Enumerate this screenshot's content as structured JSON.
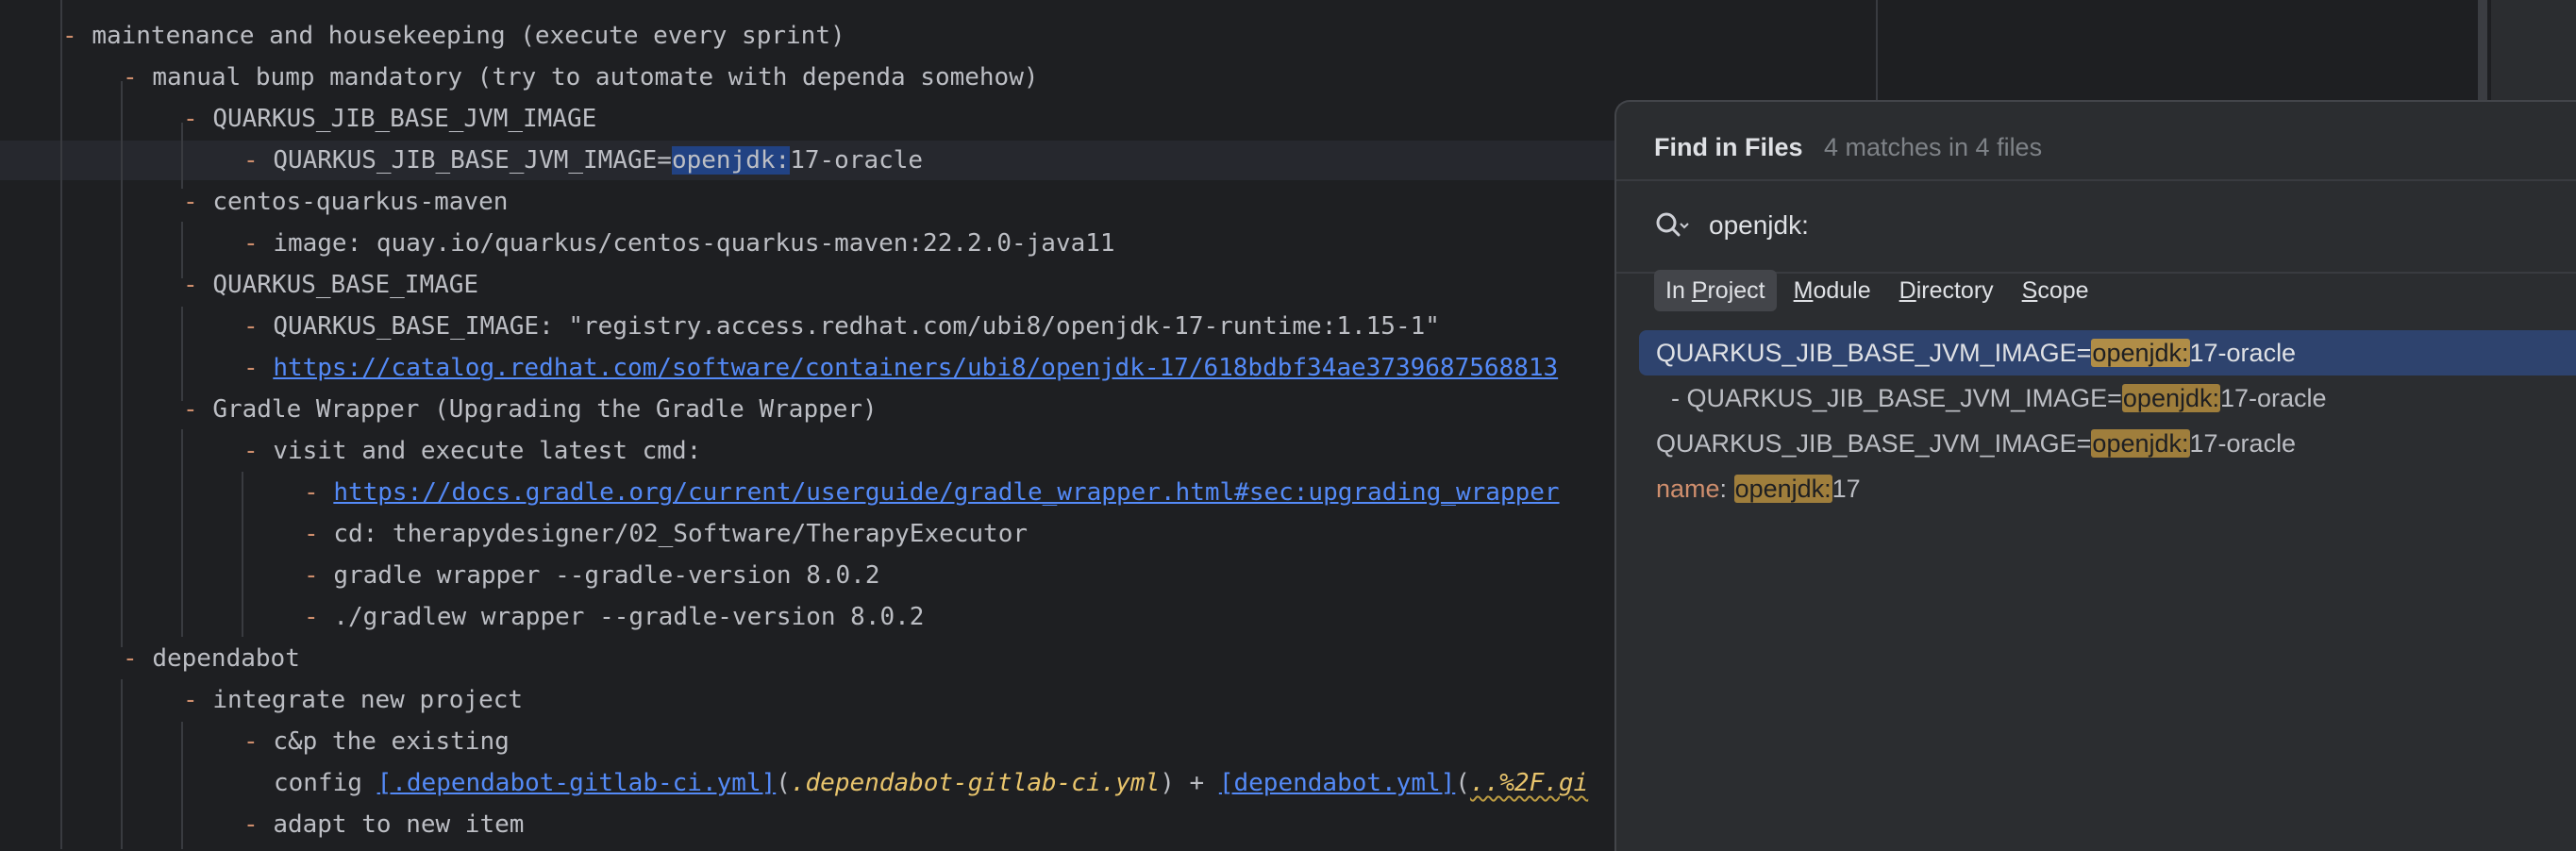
{
  "editor": {
    "lines": [
      {
        "text": "maintenance and housekeeping (execute every sprint)"
      },
      {
        "text": "manual bump mandatory (try to automate with dependa somehow)"
      },
      {
        "text": "QUARKUS_JIB_BASE_JVM_IMAGE"
      },
      {
        "prefix": "QUARKUS_JIB_BASE_JVM_IMAGE=",
        "selected": "openjdk:",
        "suffix": "17-oracle"
      },
      {
        "text": "centos-quarkus-maven"
      },
      {
        "text": "image: quay.io/quarkus/centos-quarkus-maven:22.2.0-java11"
      },
      {
        "text": "QUARKUS_BASE_IMAGE"
      },
      {
        "text": "QUARKUS_BASE_IMAGE: \"registry.access.redhat.com/ubi8/openjdk-17-runtime:1.15-1\""
      },
      {
        "link": "https://catalog.redhat.com/software/containers/ubi8/openjdk-17/618bdbf34ae3739687568813"
      },
      {
        "text": "Gradle Wrapper (Upgrading the Gradle Wrapper)"
      },
      {
        "text": "visit and execute latest cmd:"
      },
      {
        "link": "https://docs.gradle.org/current/userguide/gradle_wrapper.html#sec:upgrading_wrapper"
      },
      {
        "text": "cd: therapydesigner/02_Software/TherapyExecutor"
      },
      {
        "text": "gradle wrapper --gradle-version 8.0.2"
      },
      {
        "text": "./gradlew wrapper --gradle-version 8.0.2"
      },
      {
        "text": "dependabot"
      },
      {
        "text": "integrate new project"
      },
      {
        "text": "c&p the existing"
      },
      {
        "prefix": "config ",
        "link1": "[.dependabot-gitlab-ci.yml]",
        "paren1": "(",
        "ital1": ".dependabot-gitlab-ci.yml",
        "paren2": ") + ",
        "link2": "[dependabot.yml]",
        "paren3": "(",
        "squig": "..%2F.gi"
      },
      {
        "text": "adapt to new item"
      }
    ],
    "dash": "-"
  },
  "find": {
    "title": "Find in Files",
    "count": "4 matches in 4 files",
    "query": "openjdk:",
    "scopes": [
      {
        "pre": "In ",
        "mn": "P",
        "post": "roject"
      },
      {
        "pre": "",
        "mn": "M",
        "post": "odule"
      },
      {
        "pre": "",
        "mn": "D",
        "post": "irectory"
      },
      {
        "pre": "",
        "mn": "S",
        "post": "cope"
      }
    ],
    "results": [
      {
        "before": "QUARKUS_JIB_BASE_JVM_IMAGE=",
        "match": "openjdk:",
        "after": "17-oracle"
      },
      {
        "before": "- QUARKUS_JIB_BASE_JVM_IMAGE=",
        "match": "openjdk:",
        "after": "17-oracle"
      },
      {
        "before": "QUARKUS_JIB_BASE_JVM_IMAGE=",
        "match": "openjdk:",
        "after": "17-oracle"
      },
      {
        "key": "name",
        "before": ": ",
        "match": "openjdk:",
        "after": "17"
      }
    ]
  },
  "colors": {
    "background": "#1e1f22",
    "dash": "#cf8e6d",
    "link": "#548af7",
    "match": "#9f7e3c",
    "selected_result": "#2e436e"
  }
}
